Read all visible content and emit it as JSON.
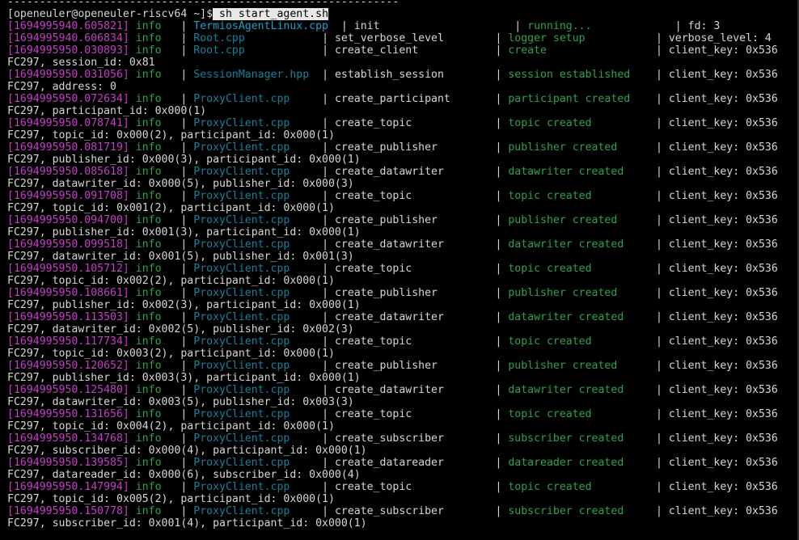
{
  "terminal": {
    "top_fragment": "-------------------------------------------------------------",
    "prompt": "[openeuler@openeuler-riscv64 ~]$",
    "command": "sh start_agent.sh",
    "colors": {
      "background": "#000000",
      "timestamp": "#c43fc6",
      "level": "#2fa150",
      "file": "#1ea1c4",
      "text": "#d6d6d6"
    },
    "logs": [
      {
        "ts": "[1694995940.605821]",
        "level": "info",
        "file": "TermiosAgentLinux.cpp",
        "fn": "init",
        "status": "running...",
        "meta": "fd: 3",
        "cont": ""
      },
      {
        "ts": "[1694995940.606834]",
        "level": "info",
        "file": "Root.cpp",
        "fn": "set_verbose_level",
        "status": "logger setup",
        "meta": "verbose_level: 4",
        "cont": ""
      },
      {
        "ts": "[1694995950.030893]",
        "level": "info",
        "file": "Root.cpp",
        "fn": "create_client",
        "status": "create",
        "meta": "client_key: 0x536",
        "cont": "FC297, session_id: 0x81"
      },
      {
        "ts": "[1694995950.031056]",
        "level": "info",
        "file": "SessionManager.hpp",
        "fn": "establish_session",
        "status": "session established",
        "meta": "client_key: 0x536",
        "cont": "FC297, address: 0"
      },
      {
        "ts": "[1694995950.072634]",
        "level": "info",
        "file": "ProxyClient.cpp",
        "fn": "create_participant",
        "status": "participant created",
        "meta": "client_key: 0x536",
        "cont": "FC297, participant_id: 0x000(1)"
      },
      {
        "ts": "[1694995950.078741]",
        "level": "info",
        "file": "ProxyClient.cpp",
        "fn": "create_topic",
        "status": "topic created",
        "meta": "client_key: 0x536",
        "cont": "FC297, topic_id: 0x000(2), participant_id: 0x000(1)"
      },
      {
        "ts": "[1694995950.081719]",
        "level": "info",
        "file": "ProxyClient.cpp",
        "fn": "create_publisher",
        "status": "publisher created",
        "meta": "client_key: 0x536",
        "cont": "FC297, publisher_id: 0x000(3), participant_id: 0x000(1)"
      },
      {
        "ts": "[1694995950.085618]",
        "level": "info",
        "file": "ProxyClient.cpp",
        "fn": "create_datawriter",
        "status": "datawriter created",
        "meta": "client_key: 0x536",
        "cont": "FC297, datawriter_id: 0x000(5), publisher_id: 0x000(3)"
      },
      {
        "ts": "[1694995950.091708]",
        "level": "info",
        "file": "ProxyClient.cpp",
        "fn": "create_topic",
        "status": "topic created",
        "meta": "client_key: 0x536",
        "cont": "FC297, topic_id: 0x001(2), participant_id: 0x000(1)"
      },
      {
        "ts": "[1694995950.094700]",
        "level": "info",
        "file": "ProxyClient.cpp",
        "fn": "create_publisher",
        "status": "publisher created",
        "meta": "client_key: 0x536",
        "cont": "FC297, publisher_id: 0x001(3), participant_id: 0x000(1)"
      },
      {
        "ts": "[1694995950.099518]",
        "level": "info",
        "file": "ProxyClient.cpp",
        "fn": "create_datawriter",
        "status": "datawriter created",
        "meta": "client_key: 0x536",
        "cont": "FC297, datawriter_id: 0x001(5), publisher_id: 0x001(3)"
      },
      {
        "ts": "[1694995950.105712]",
        "level": "info",
        "file": "ProxyClient.cpp",
        "fn": "create_topic",
        "status": "topic created",
        "meta": "client_key: 0x536",
        "cont": "FC297, topic_id: 0x002(2), participant_id: 0x000(1)"
      },
      {
        "ts": "[1694995950.108661]",
        "level": "info",
        "file": "ProxyClient.cpp",
        "fn": "create_publisher",
        "status": "publisher created",
        "meta": "client_key: 0x536",
        "cont": "FC297, publisher_id: 0x002(3), participant_id: 0x000(1)"
      },
      {
        "ts": "[1694995950.113503]",
        "level": "info",
        "file": "ProxyClient.cpp",
        "fn": "create_datawriter",
        "status": "datawriter created",
        "meta": "client_key: 0x536",
        "cont": "FC297, datawriter_id: 0x002(5), publisher_id: 0x002(3)"
      },
      {
        "ts": "[1694995950.117734]",
        "level": "info",
        "file": "ProxyClient.cpp",
        "fn": "create_topic",
        "status": "topic created",
        "meta": "client_key: 0x536",
        "cont": "FC297, topic_id: 0x003(2), participant_id: 0x000(1)"
      },
      {
        "ts": "[1694995950.120652]",
        "level": "info",
        "file": "ProxyClient.cpp",
        "fn": "create_publisher",
        "status": "publisher created",
        "meta": "client_key: 0x536",
        "cont": "FC297, publisher_id: 0x003(3), participant_id: 0x000(1)"
      },
      {
        "ts": "[1694995950.125480]",
        "level": "info",
        "file": "ProxyClient.cpp",
        "fn": "create_datawriter",
        "status": "datawriter created",
        "meta": "client_key: 0x536",
        "cont": "FC297, datawriter_id: 0x003(5), publisher_id: 0x003(3)"
      },
      {
        "ts": "[1694995950.131656]",
        "level": "info",
        "file": "ProxyClient.cpp",
        "fn": "create_topic",
        "status": "topic created",
        "meta": "client_key: 0x536",
        "cont": "FC297, topic_id: 0x004(2), participant_id: 0x000(1)"
      },
      {
        "ts": "[1694995950.134768]",
        "level": "info",
        "file": "ProxyClient.cpp",
        "fn": "create_subscriber",
        "status": "subscriber created",
        "meta": "client_key: 0x536",
        "cont": "FC297, subscriber_id: 0x000(4), participant_id: 0x000(1)"
      },
      {
        "ts": "[1694995950.139585]",
        "level": "info",
        "file": "ProxyClient.cpp",
        "fn": "create_datareader",
        "status": "datareader created",
        "meta": "client_key: 0x536",
        "cont": "FC297, datareader_id: 0x000(6), subscriber_id: 0x000(4)"
      },
      {
        "ts": "[1694995950.147994]",
        "level": "info",
        "file": "ProxyClient.cpp",
        "fn": "create_topic",
        "status": "topic created",
        "meta": "client_key: 0x536",
        "cont": "FC297, topic_id: 0x005(2), participant_id: 0x000(1)"
      },
      {
        "ts": "[1694995950.150778]",
        "level": "info",
        "file": "ProxyClient.cpp",
        "fn": "create_subscriber",
        "status": "subscriber created",
        "meta": "client_key: 0x536",
        "cont": "FC297, subscriber_id: 0x001(4), participant_id: 0x000(1)"
      }
    ]
  }
}
